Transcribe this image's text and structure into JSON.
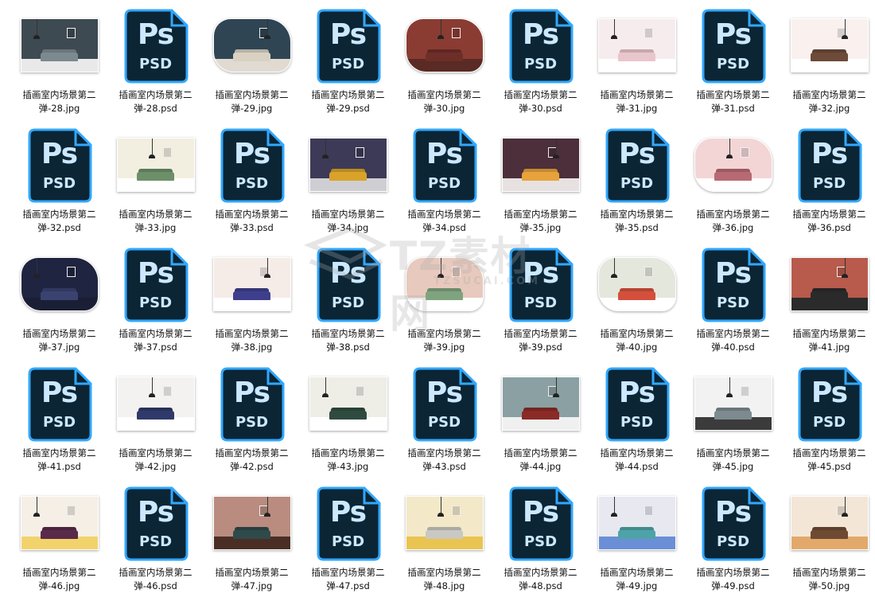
{
  "files": [
    {
      "name": "插画室内场景第二弹-28.jpg",
      "type": "jpg",
      "wall": "#3e4a52",
      "floor": "#e9e9e9",
      "sofa": "#7c8a90",
      "round": false
    },
    {
      "name": "插画室内场景第二弹-28.psd",
      "type": "psd"
    },
    {
      "name": "插画室内场景第二弹-29.jpg",
      "type": "jpg",
      "wall": "#2f4554",
      "floor": "#e0dad1",
      "sofa": "#d9d2c3",
      "round": true
    },
    {
      "name": "插画室内场景第二弹-29.psd",
      "type": "psd"
    },
    {
      "name": "插画室内场景第二弹-30.jpg",
      "type": "jpg",
      "wall": "#8a3c33",
      "floor": "#5a2a24",
      "sofa": "#6e2e28",
      "round": true
    },
    {
      "name": "插画室内场景第二弹-30.psd",
      "type": "psd"
    },
    {
      "name": "插画室内场景第二弹-31.jpg",
      "type": "jpg",
      "wall": "#f6ecee",
      "floor": "#ffffff",
      "sofa": "#e9c6cc",
      "round": false
    },
    {
      "name": "插画室内场景第二弹-31.psd",
      "type": "psd"
    },
    {
      "name": "插画室内场景第二弹-32.jpg",
      "type": "jpg",
      "wall": "#faf1ef",
      "floor": "#ffffff",
      "sofa": "#6d4a3a",
      "round": false
    },
    {
      "name": "插画室内场景第二弹-32.psd",
      "type": "psd"
    },
    {
      "name": "插画室内场景第二弹-33.jpg",
      "type": "jpg",
      "wall": "#f2efe0",
      "floor": "#ffffff",
      "sofa": "#6c8f6a",
      "round": false
    },
    {
      "name": "插画室内场景第二弹-33.psd",
      "type": "psd"
    },
    {
      "name": "插画室内场景第二弹-34.jpg",
      "type": "jpg",
      "wall": "#3c3a57",
      "floor": "#cfcfd3",
      "sofa": "#d9a229",
      "round": false
    },
    {
      "name": "插画室内场景第二弹-34.psd",
      "type": "psd"
    },
    {
      "name": "插画室内场景第二弹-35.jpg",
      "type": "jpg",
      "wall": "#4c2f3a",
      "floor": "#e7e1e1",
      "sofa": "#e7a23b",
      "round": false
    },
    {
      "name": "插画室内场景第二弹-35.psd",
      "type": "psd"
    },
    {
      "name": "插画室内场景第二弹-36.jpg",
      "type": "jpg",
      "wall": "#f3d5d6",
      "floor": "#ffffff",
      "sofa": "#b76a73",
      "round": true
    },
    {
      "name": "插画室内场景第二弹-36.psd",
      "type": "psd"
    },
    {
      "name": "插画室内场景第二弹-37.jpg",
      "type": "jpg",
      "wall": "#1f2440",
      "floor": "#1a1f36",
      "sofa": "#3a4270",
      "round": true
    },
    {
      "name": "插画室内场景第二弹-37.psd",
      "type": "psd"
    },
    {
      "name": "插画室内场景第二弹-38.jpg",
      "type": "jpg",
      "wall": "#f5ece8",
      "floor": "#ffffff",
      "sofa": "#3e3f8c",
      "round": false
    },
    {
      "name": "插画室内场景第二弹-38.psd",
      "type": "psd"
    },
    {
      "name": "插画室内场景第二弹-39.jpg",
      "type": "jpg",
      "wall": "#e8c9bd",
      "floor": "#ffffff",
      "sofa": "#7fa37f",
      "round": true
    },
    {
      "name": "插画室内场景第二弹-39.psd",
      "type": "psd"
    },
    {
      "name": "插画室内场景第二弹-40.jpg",
      "type": "jpg",
      "wall": "#e4e7dc",
      "floor": "#ffffff",
      "sofa": "#d4503c",
      "round": true
    },
    {
      "name": "插画室内场景第二弹-40.psd",
      "type": "psd"
    },
    {
      "name": "插画室内场景第二弹-41.jpg",
      "type": "jpg",
      "wall": "#b85a4c",
      "floor": "#2b2b2b",
      "sofa": "#2a2a2a",
      "round": false
    },
    {
      "name": "插画室内场景第二弹-41.psd",
      "type": "psd"
    },
    {
      "name": "插画室内场景第二弹-42.jpg",
      "type": "jpg",
      "wall": "#f3f2f0",
      "floor": "#ffffff",
      "sofa": "#2f3a6a",
      "round": false
    },
    {
      "name": "插画室内场景第二弹-42.psd",
      "type": "psd"
    },
    {
      "name": "插画室内场景第二弹-43.jpg",
      "type": "jpg",
      "wall": "#eeede6",
      "floor": "#ffffff",
      "sofa": "#2f4b3f",
      "round": false
    },
    {
      "name": "插画室内场景第二弹-43.psd",
      "type": "psd"
    },
    {
      "name": "插画室内场景第二弹-44.jpg",
      "type": "jpg",
      "wall": "#8aa0a3",
      "floor": "#f0f0f0",
      "sofa": "#8b2a26",
      "round": false
    },
    {
      "name": "插画室内场景第二弹-44.psd",
      "type": "psd"
    },
    {
      "name": "插画室内场景第二弹-45.jpg",
      "type": "jpg",
      "wall": "#f2f2f2",
      "floor": "#3b3b3b",
      "sofa": "#7d8a90",
      "round": false
    },
    {
      "name": "插画室内场景第二弹-45.psd",
      "type": "psd"
    },
    {
      "name": "插画室内场景第二弹-46.jpg",
      "type": "jpg",
      "wall": "#f5efe6",
      "floor": "#f2d36b",
      "sofa": "#5a2a4a",
      "round": false
    },
    {
      "name": "插画室内场景第二弹-46.psd",
      "type": "psd"
    },
    {
      "name": "插画室内场景第二弹-47.jpg",
      "type": "jpg",
      "wall": "#b98c7f",
      "floor": "#4a2e26",
      "sofa": "#2f4a4a",
      "round": false
    },
    {
      "name": "插画室内场景第二弹-47.psd",
      "type": "psd"
    },
    {
      "name": "插画室内场景第二弹-48.jpg",
      "type": "jpg",
      "wall": "#f3e8c8",
      "floor": "#e9c451",
      "sofa": "#c9c8c2",
      "round": false
    },
    {
      "name": "插画室内场景第二弹-48.psd",
      "type": "psd"
    },
    {
      "name": "插画室内场景第二弹-49.jpg",
      "type": "jpg",
      "wall": "#e7e8f0",
      "floor": "#6a8fd6",
      "sofa": "#4ea3a8",
      "round": false
    },
    {
      "name": "插画室内场景第二弹-49.psd",
      "type": "psd"
    },
    {
      "name": "插画室内场景第二弹-50.jpg",
      "type": "jpg",
      "wall": "#f4e6d6",
      "floor": "#e2a96a",
      "sofa": "#6e4a33",
      "round": false
    }
  ],
  "psd_icon": {
    "ps_text": "Ps",
    "psd_text": "PSD",
    "body_color": "#0b2535",
    "border_color": "#31a8ff",
    "text_color": "#cbe8ff"
  },
  "watermark": {
    "text": "TZ素材网",
    "sub": "TZSUCAI.COM"
  }
}
